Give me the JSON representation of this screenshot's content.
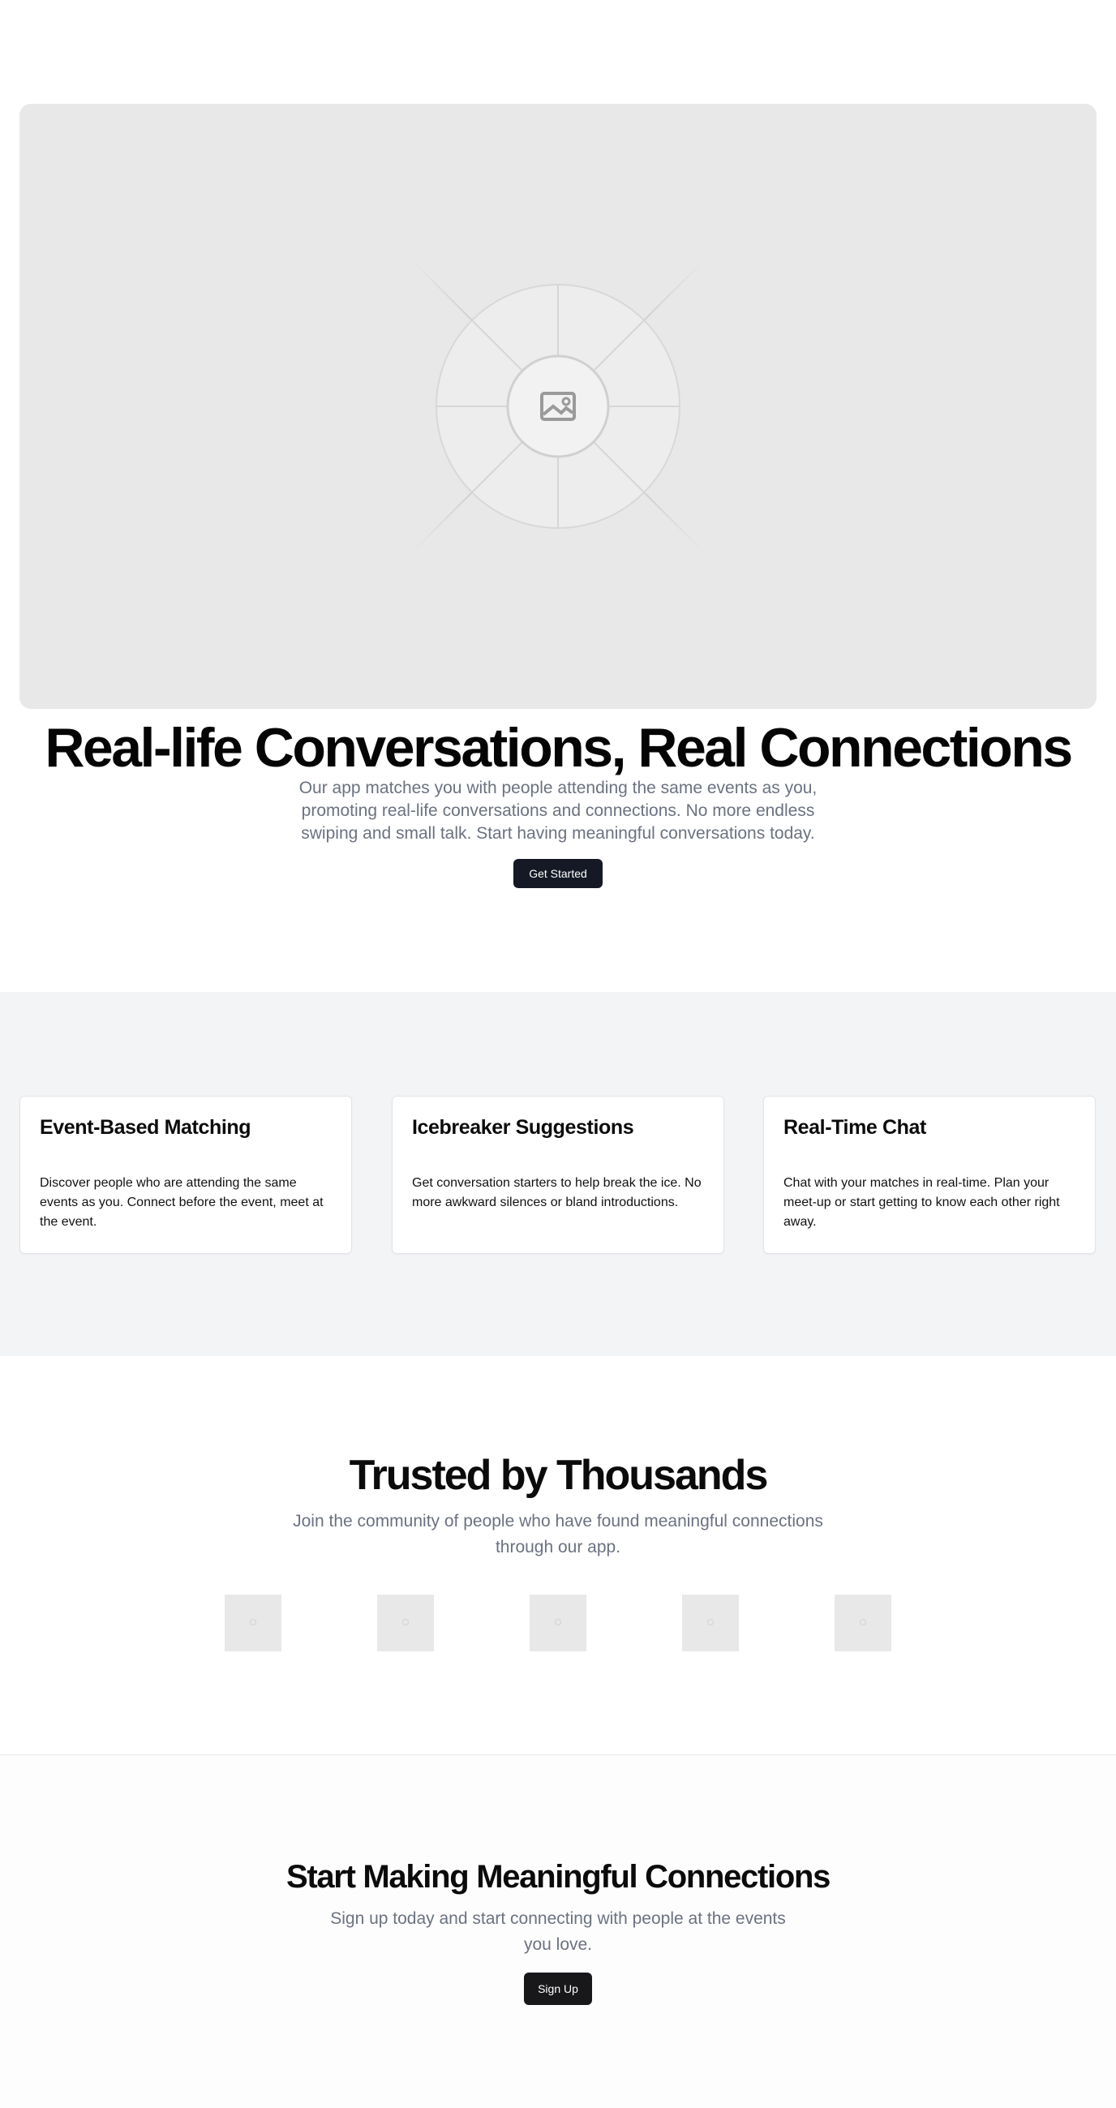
{
  "hero": {
    "image_icon": "image-placeholder-icon",
    "title": "Real-life Conversations, Real Connections",
    "subtitle": "Our app matches you with people attending the same events as you, promoting real-life conversations and connections. No more endless swiping and small talk. Start having meaningful conversations today.",
    "cta_label": "Get Started"
  },
  "features": {
    "cards": [
      {
        "title": "Event-Based Matching",
        "description": "Discover people who are attending the same events as you. Connect before the event, meet at the event."
      },
      {
        "title": "Icebreaker Suggestions",
        "description": "Get conversation starters to help break the ice. No more awkward silences or bland introductions."
      },
      {
        "title": "Real-Time Chat",
        "description": "Chat with your matches in real-time. Plan your meet-up or start getting to know each other right away."
      }
    ]
  },
  "trusted": {
    "title": "Trusted by Thousands",
    "subtitle": "Join the community of people who have found meaningful connections through our app.",
    "logo_count_icon": "logo-placeholder-icon"
  },
  "cta": {
    "title": "Start Making Meaningful Connections",
    "subtitle": "Sign up today and start connecting with people at the events you love.",
    "button_label": "Sign Up"
  },
  "colors": {
    "primary_button": "#141925",
    "muted_text": "#6b7280",
    "section_bg": "#f3f4f6",
    "placeholder_bg": "#e8e8e8"
  }
}
